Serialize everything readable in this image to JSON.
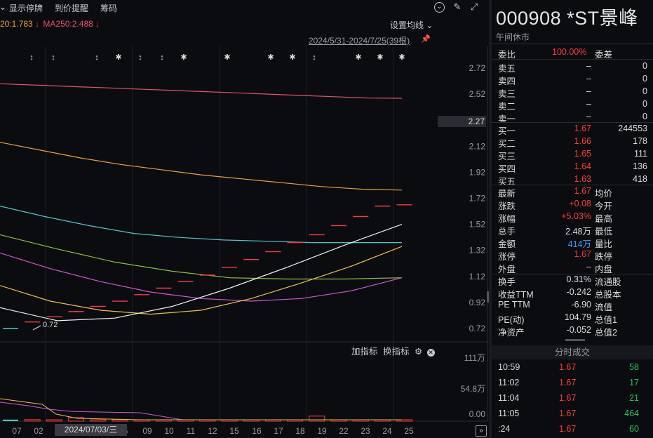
{
  "toolbar": {
    "show_suspended": "显示停牌",
    "price_alert": "到价提醒",
    "chips": "筹码"
  },
  "ma_legend": {
    "ma120_text": "20:1.783",
    "ma120_arrow": "↓",
    "ma250_text": "MA250:2.488",
    "ma250_arrow": "↓",
    "colors": {
      "ma120": "#f0a040",
      "ma250": "#e8506a"
    }
  },
  "chart_header": {
    "setting_label": "设置均线",
    "date_range": "2024/5/31-2024/7/25(39根)"
  },
  "price_axis": {
    "ticks": [
      "2.72",
      "2.52",
      "2.27",
      "2.12",
      "1.92",
      "1.72",
      "1.52",
      "1.32",
      "1.12",
      "0.92",
      "0.72"
    ],
    "current_price_label": "2.27"
  },
  "low_annotation": "0.72",
  "volume_panel": {
    "add_indicator": "加指标",
    "switch_indicator": "换指标",
    "axis_ticks": [
      "111万",
      "54.8万",
      "0.00"
    ]
  },
  "x_axis": {
    "labels": [
      "07",
      "02",
      "2024/07/03/三",
      "5",
      "09",
      "10",
      "11",
      "12",
      "15",
      "16",
      "17",
      "18",
      "19",
      "22",
      "23",
      "24",
      "25"
    ],
    "crosshair_label": "2024/07/03/三"
  },
  "chart_data": {
    "type": "candlestick",
    "note_symbols": [
      "↕",
      "↕",
      "↕",
      "✱",
      "↕",
      "↕",
      "✱",
      "✱",
      "✱",
      "✱",
      "↕",
      "✱",
      "✱",
      "✱"
    ],
    "ylim": [
      0.62,
      2.82
    ],
    "candles": [
      0.72,
      0.77,
      0.81,
      0.85,
      0.89,
      0.93,
      0.98,
      1.03,
      1.08,
      1.13,
      1.19,
      1.25,
      1.31,
      1.38,
      1.44,
      1.51,
      1.58,
      1.66,
      1.67
    ],
    "series": [
      {
        "name": "MA250",
        "color": "#e8506a",
        "values": [
          2.6,
          2.59,
          2.58,
          2.57,
          2.56,
          2.55,
          2.54,
          2.53,
          2.52,
          2.51,
          2.5,
          2.49,
          2.488
        ]
      },
      {
        "name": "MA120",
        "color": "#f0a040",
        "values": [
          2.15,
          2.09,
          2.03,
          1.98,
          1.94,
          1.9,
          1.87,
          1.84,
          1.81,
          1.79,
          1.783
        ]
      },
      {
        "name": "MA60",
        "color": "#4fc7c9",
        "values": [
          1.66,
          1.58,
          1.51,
          1.45,
          1.42,
          1.4,
          1.39,
          1.38,
          1.38,
          1.38
        ]
      },
      {
        "name": "MA30",
        "color": "#8cc43c",
        "values": [
          1.44,
          1.33,
          1.23,
          1.16,
          1.11,
          1.1,
          1.1,
          1.11
        ]
      },
      {
        "name": "MA20",
        "color": "#d355d5",
        "values": [
          1.3,
          1.18,
          1.08,
          1.0,
          0.95,
          0.93,
          0.95,
          1.01,
          1.11
        ]
      },
      {
        "name": "MA10",
        "color": "#e8c24a",
        "values": [
          1.05,
          0.93,
          0.86,
          0.83,
          0.86,
          0.95,
          1.07,
          1.2,
          1.35
        ]
      },
      {
        "name": "MA5",
        "color": "#f2f2f2",
        "values": [
          0.88,
          0.78,
          0.8,
          0.89,
          1.03,
          1.19,
          1.36,
          1.52
        ]
      }
    ],
    "volume": {
      "ylim": [
        0,
        111
      ],
      "bars": [
        3,
        3,
        2,
        7,
        2,
        2,
        2,
        2,
        2,
        2,
        2,
        2,
        2,
        2,
        10,
        2,
        2,
        2,
        2
      ]
    }
  },
  "quote": {
    "code_name": "000908 *ST景峰",
    "status": "午间休市",
    "weibi_label": "委比",
    "weibi_value": "100.00%",
    "weicha_label": "委差",
    "asks": [
      {
        "label": "卖五",
        "price": "–",
        "vol": "0"
      },
      {
        "label": "卖四",
        "price": "–",
        "vol": "0"
      },
      {
        "label": "卖三",
        "price": "–",
        "vol": "0"
      },
      {
        "label": "卖二",
        "price": "–",
        "vol": "0"
      },
      {
        "label": "卖一",
        "price": "–",
        "vol": "0"
      }
    ],
    "bids": [
      {
        "label": "买一",
        "price": "1.67",
        "vol": "244553"
      },
      {
        "label": "买二",
        "price": "1.66",
        "vol": "178"
      },
      {
        "label": "买三",
        "price": "1.65",
        "vol": "111"
      },
      {
        "label": "买四",
        "price": "1.64",
        "vol": "136"
      },
      {
        "label": "买五",
        "price": "1.63",
        "vol": "418"
      }
    ],
    "stats": [
      {
        "l1": "最新",
        "v1": "1.67",
        "c1": "red",
        "l2": "均价"
      },
      {
        "l1": "涨跌",
        "v1": "+0.08",
        "c1": "red",
        "l2": "今开"
      },
      {
        "l1": "涨幅",
        "v1": "+5.03%",
        "c1": "red",
        "l2": "最高"
      },
      {
        "l1": "总手",
        "v1": "2.48万",
        "c1": "white",
        "l2": "最低"
      },
      {
        "l1": "金额",
        "v1": "414万",
        "c1": "blue",
        "l2": "量比"
      },
      {
        "l1": "涨停",
        "v1": "1.67",
        "c1": "red",
        "l2": "跌停"
      },
      {
        "l1": "外盘",
        "v1": "–",
        "c1": "white",
        "l2": "内盘"
      }
    ],
    "fundamentals": [
      {
        "l1": "换手",
        "v1": "0.31%",
        "l2": "流通股"
      },
      {
        "l1": "收益TTM",
        "v1": "-0.242",
        "l2": "总股本"
      },
      {
        "l1": "PE TTM",
        "v1": "-6.90",
        "l2": "流值"
      },
      {
        "l1": "PE(动)",
        "v1": "104.79",
        "l2": "总值1"
      },
      {
        "l1": "净资产",
        "v1": "-0.052",
        "l2": "总值2"
      }
    ],
    "trades_title": "分时成交",
    "trades": [
      {
        "time": "10:59",
        "price": "1.67",
        "vol": "58"
      },
      {
        "time": "11:02",
        "price": "1.67",
        "vol": "17"
      },
      {
        "time": "11:04",
        "price": "1.67",
        "vol": "21"
      },
      {
        "time": "11:05",
        "price": "1.67",
        "vol": "464"
      },
      {
        "time": ":24",
        "price": "1.67",
        "vol": "60"
      }
    ]
  }
}
